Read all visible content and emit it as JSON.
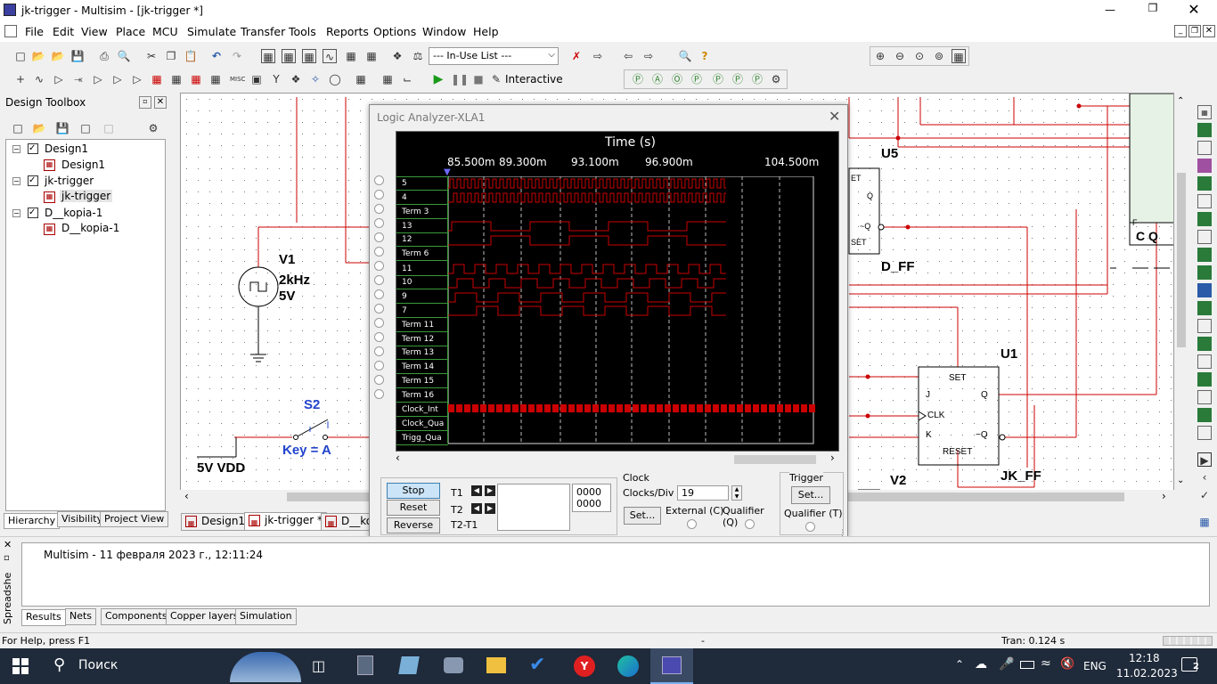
{
  "window": {
    "title": "jk-trigger - Multisim - [jk-trigger *]"
  },
  "menu": [
    "File",
    "Edit",
    "View",
    "Place",
    "MCU",
    "Simulate",
    "Transfer",
    "Tools",
    "Reports",
    "Options",
    "Window",
    "Help"
  ],
  "toolbar": {
    "in_use_list": "--- In-Use List ---",
    "interactive": "Interactive"
  },
  "toolbox": {
    "title": "Design Toolbox",
    "tree": [
      {
        "label": "Design1",
        "level": 0
      },
      {
        "label": "Design1",
        "level": 1
      },
      {
        "label": "jk-trigger",
        "level": 0
      },
      {
        "label": "jk-trigger",
        "level": 1
      },
      {
        "label": "D__kopia-1",
        "level": 0
      },
      {
        "label": "D__kopia-1",
        "level": 1
      }
    ],
    "tabs": [
      "Hierarchy",
      "Visibility",
      "Project View"
    ]
  },
  "schematic": {
    "v1": {
      "name": "V1",
      "freq": "2kHz",
      "volt": "5V"
    },
    "s2": {
      "name": "S2",
      "key": "Key = A"
    },
    "vdd": "5V VDD",
    "u5": "U5",
    "dff": "D_FF",
    "u1": "U1",
    "jkff": "JK_FF",
    "v2": "V2",
    "cq": "C  Q",
    "ff_pins": {
      "set": "SET",
      "j": "J",
      "q": "Q",
      "clk": "CLK",
      "k": "K",
      "nq": "~Q",
      "reset": "RESET"
    },
    "u5_pins": {
      "q": "Q",
      "nq": "~Q",
      "set": "ET",
      "reset": "SET",
      "f": "F"
    },
    "tabs": [
      "Design1",
      "jk-trigger *",
      "D__ko"
    ]
  },
  "logic_analyzer": {
    "title": "Logic Analyzer-XLA1",
    "time_title": "Time (s)",
    "time_labels": [
      "85.500m",
      "89.300m",
      "93.100m",
      "96.900m",
      "104.500m"
    ],
    "channels": [
      "5",
      "4",
      "Term 3",
      "13",
      "12",
      "Term 6",
      "11",
      "10",
      "9",
      "7",
      "Term 11",
      "Term 12",
      "Term 13",
      "Term 14",
      "Term 15",
      "Term 16",
      "Clock_Int",
      "Clock_Qua",
      "Trigg_Qua"
    ],
    "buttons": {
      "stop": "Stop",
      "reset": "Reset",
      "reverse": "Reverse"
    },
    "t_labels": {
      "t1": "T1",
      "t2": "T2",
      "t2t1": "T2-T1"
    },
    "t_values": [
      "0000",
      "0000"
    ],
    "clock": {
      "title": "Clock",
      "clocks_div_label": "Clocks/Div",
      "clocks_div": "19",
      "set": "Set...",
      "external": "External (C)",
      "qualifier": "Qualifier (Q)"
    },
    "trigger": {
      "title": "Trigger",
      "set": "Set...",
      "qualifier": "Qualifier (T)"
    }
  },
  "spreadsheet": {
    "message": "Multisim  -  11 февраля 2023 г., 12:11:24",
    "side_label": "Spreadshe",
    "tabs": [
      "Results",
      "Nets",
      "Components",
      "Copper layers",
      "Simulation"
    ]
  },
  "status": {
    "help": "For Help, press F1",
    "dash": "-",
    "tran": "Tran: 0.124 s"
  },
  "taskbar": {
    "search": "Поиск",
    "lang": "ENG",
    "time": "12:18",
    "date": "11.02.2023",
    "notif": "2"
  },
  "colors": {
    "wire": "#cc0000",
    "la_bg": "#000000",
    "la_label_bg": "#000000",
    "la_green": "#3a9a3a",
    "sel_btn": "#cce4f7",
    "taskbar": "#1f2a3a"
  }
}
